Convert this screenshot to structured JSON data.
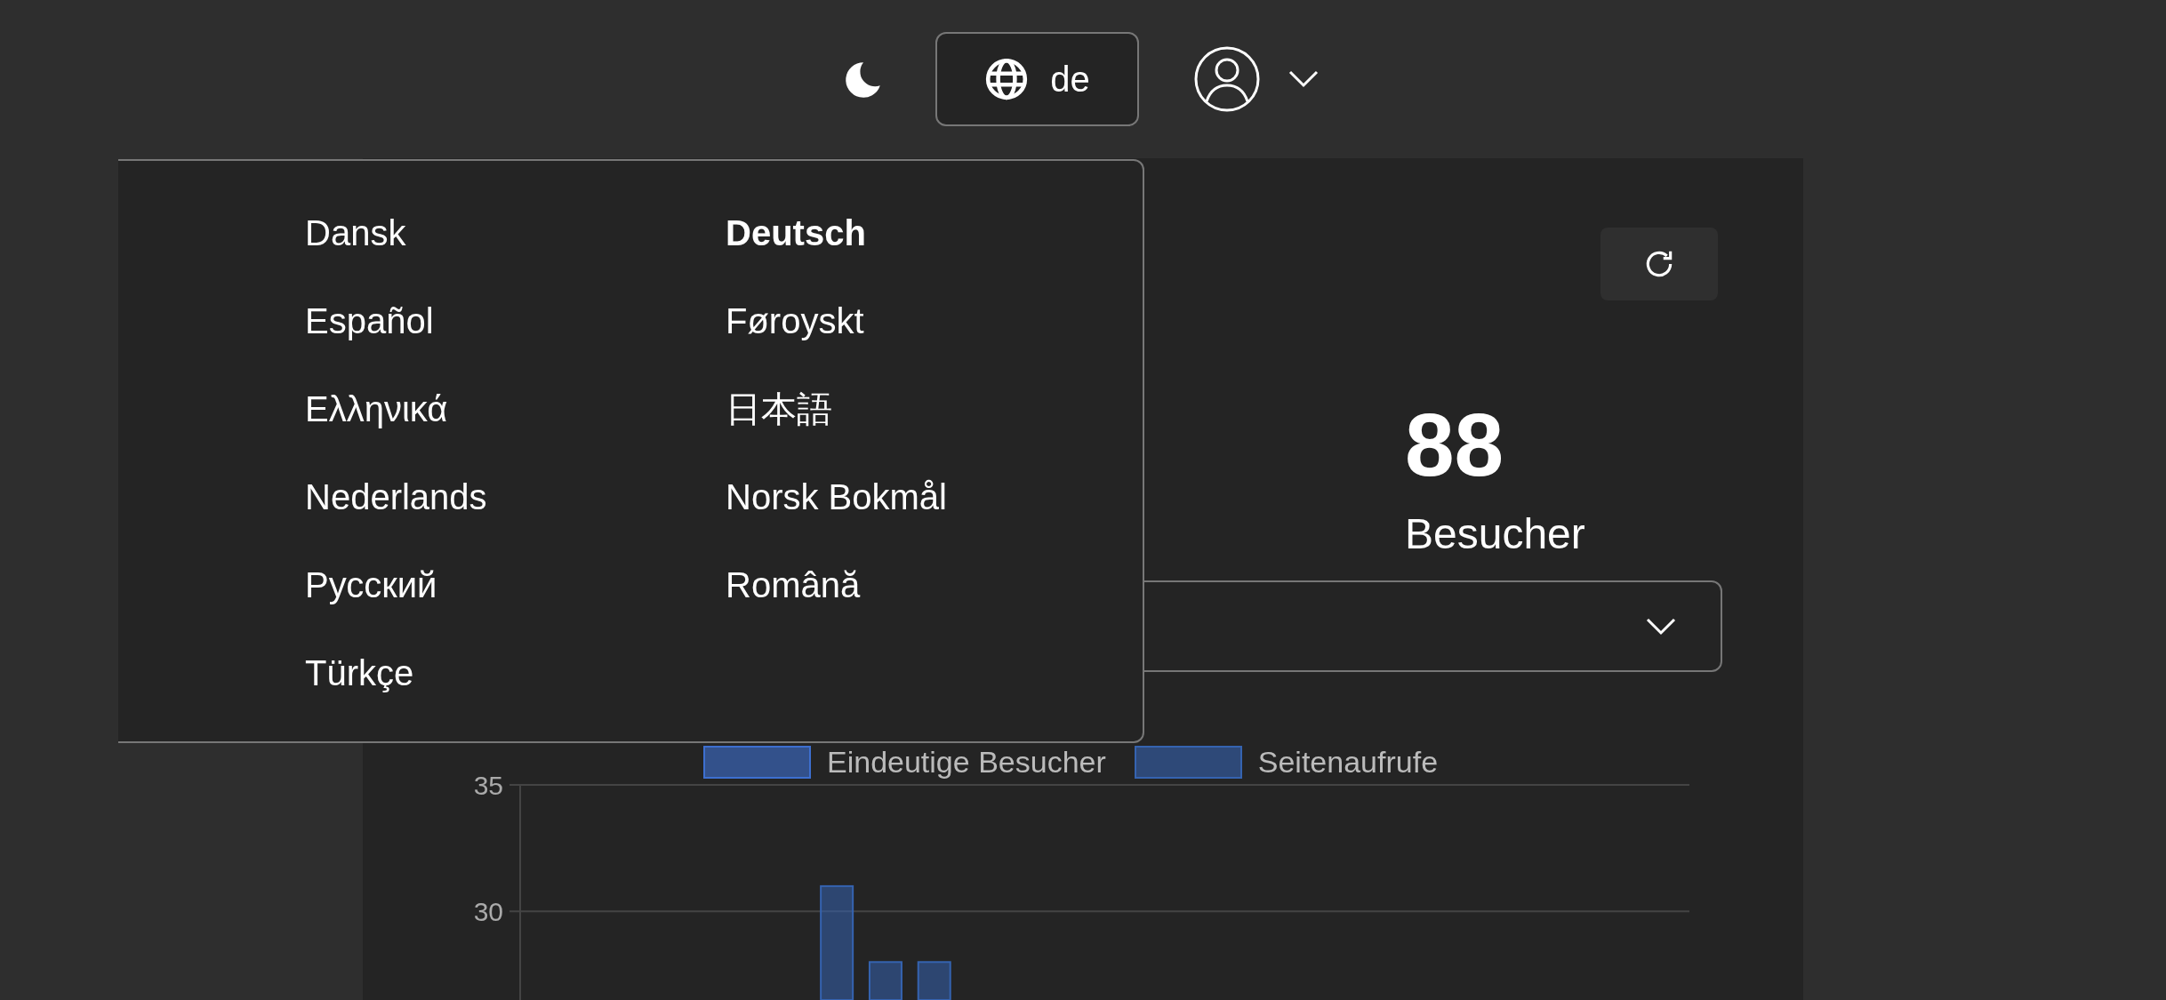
{
  "header": {
    "language_button": {
      "label": "de"
    }
  },
  "language_menu": {
    "open": true,
    "items": [
      {
        "label": "Dansk",
        "selected": false
      },
      {
        "label": "Deutsch",
        "selected": true
      },
      {
        "label": "Español",
        "selected": false
      },
      {
        "label": "Føroyskt",
        "selected": false
      },
      {
        "label": "Ελληνικά",
        "selected": false
      },
      {
        "label": "日本語",
        "selected": false
      },
      {
        "label": "Nederlands",
        "selected": false
      },
      {
        "label": "Norsk Bokmål",
        "selected": false
      },
      {
        "label": "Русский",
        "selected": false
      },
      {
        "label": "Română",
        "selected": false
      },
      {
        "label": "Türkçe",
        "selected": false
      }
    ]
  },
  "stat": {
    "value": "88",
    "label": "Besucher"
  },
  "chart": {
    "chart_data": {
      "type": "bar",
      "ylim": [
        26.5,
        35
      ],
      "yticks": [
        30,
        35
      ],
      "series": [
        {
          "name": "Eindeutige Besucher",
          "color": "#3d6fd0",
          "values": [
            null,
            null,
            null,
            null,
            null,
            null,
            null,
            null,
            null,
            null,
            null,
            null,
            null,
            null,
            null,
            null,
            null,
            null,
            null,
            null,
            null,
            null,
            null,
            null
          ]
        },
        {
          "name": "Seitenaufrufe",
          "color": "#3563b0",
          "values": [
            null,
            null,
            null,
            null,
            null,
            null,
            31,
            28,
            28,
            null,
            null,
            null,
            null,
            null,
            null,
            null,
            null,
            null,
            null,
            null,
            null,
            null,
            null,
            null
          ]
        }
      ]
    }
  }
}
